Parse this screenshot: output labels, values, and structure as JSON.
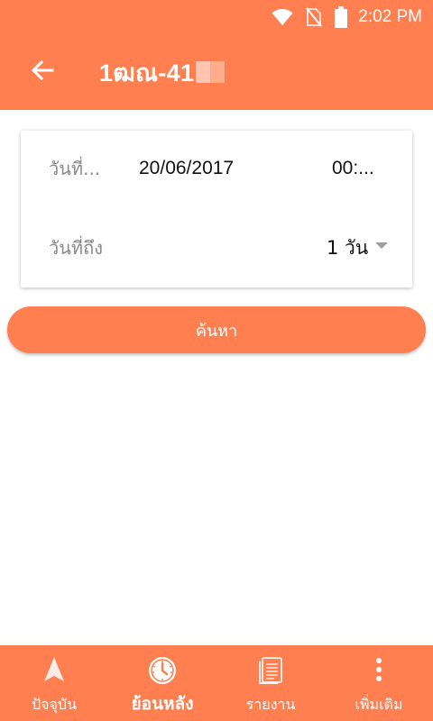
{
  "colors": {
    "primary": "#ff7f50",
    "text_primary": "#111111",
    "text_secondary": "#8a8a8a",
    "on_primary": "#ffffff"
  },
  "status_bar": {
    "time": "2:02 PM",
    "icons": [
      "wifi-icon",
      "no-sim-icon",
      "battery-icon"
    ]
  },
  "app_bar": {
    "title": "1ฒณ-41",
    "back_icon": "arrow-left-icon"
  },
  "form": {
    "start": {
      "label": "วันที่...",
      "date": "20/06/2017",
      "time": "00:..."
    },
    "range": {
      "label": "วันที่ถึง",
      "selected": "1 วัน",
      "icon": "dropdown-caret-icon"
    }
  },
  "search_button": {
    "label": "ค้นหา"
  },
  "bottom_nav": {
    "items": [
      {
        "label": "ปัจจุบัน",
        "icon": "navigation-arrow-icon",
        "active": false
      },
      {
        "label": "ย้อนหลัง",
        "icon": "clock-history-icon",
        "active": true
      },
      {
        "label": "รายงาน",
        "icon": "report-document-icon",
        "active": false
      },
      {
        "label": "เพิ่มเติม",
        "icon": "more-vertical-icon",
        "active": false
      }
    ]
  }
}
